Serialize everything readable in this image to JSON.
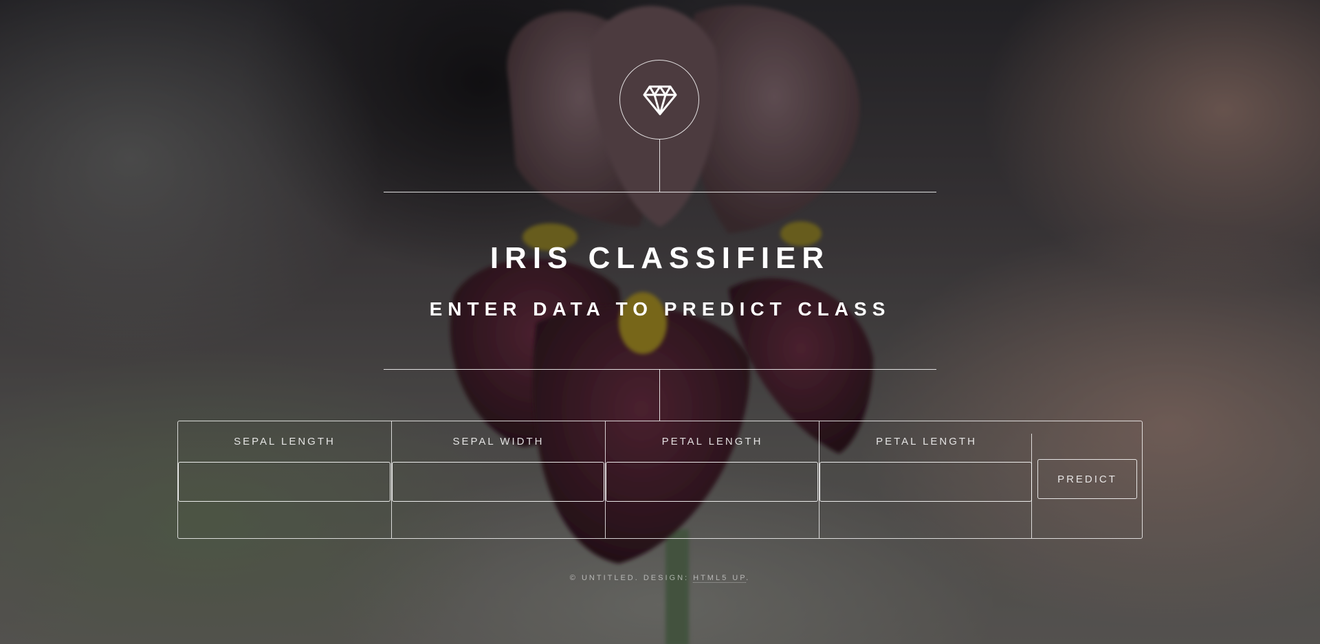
{
  "header": {
    "logo_icon": "diamond-icon",
    "title": "IRIS CLASSIFIER",
    "subtitle": "ENTER DATA TO PREDICT CLASS"
  },
  "form": {
    "fields": [
      {
        "label": "SEPAL LENGTH",
        "value": ""
      },
      {
        "label": "SEPAL WIDTH",
        "value": ""
      },
      {
        "label": "PETAL LENGTH",
        "value": ""
      },
      {
        "label": "PETAL LENGTH",
        "value": ""
      }
    ],
    "submit_label": "PREDICT"
  },
  "footer": {
    "copyright": "© UNTITLED. DESIGN: ",
    "link_text": "HTML5 UP",
    "trailing": "."
  },
  "colors": {
    "text": "#ffffff",
    "line": "rgba(255,255,255,0.85)"
  }
}
